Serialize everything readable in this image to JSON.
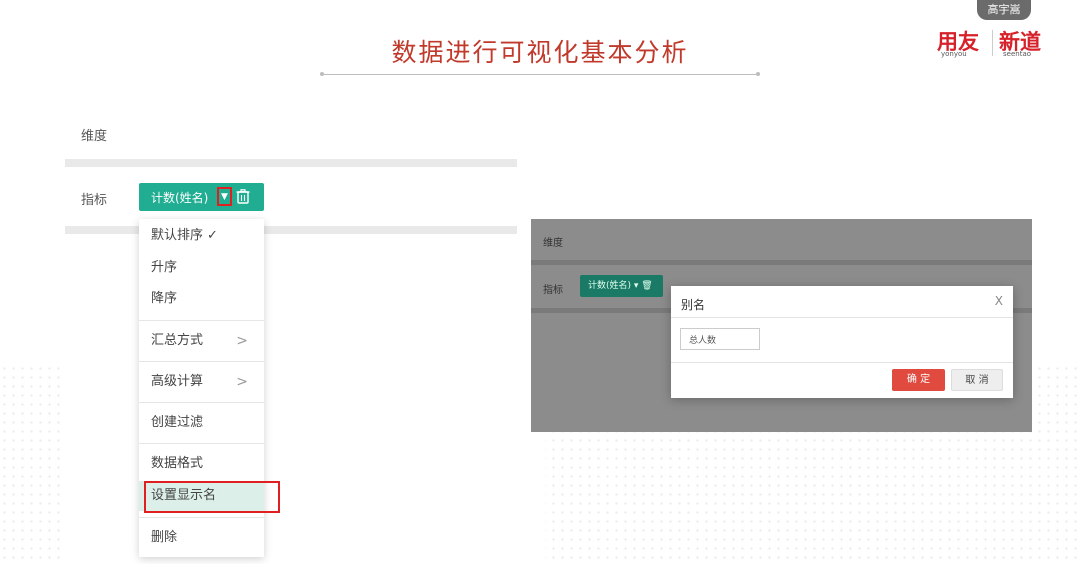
{
  "presenter": {
    "name": "高宇嵩"
  },
  "slide": {
    "title": "数据进行可视化基本分析"
  },
  "logo": {
    "brand1": "用友",
    "brand1_sub": "yonyou",
    "brand2": "新道",
    "brand2_sub": "seentao"
  },
  "left": {
    "dimension_label": "维度",
    "measure_label": "指标",
    "measure_pill": "计数(姓名)",
    "caret_icon": "▼",
    "menu": [
      {
        "label": "默认排序",
        "check": "✓"
      },
      {
        "label": "升序"
      },
      {
        "label": "降序"
      },
      {
        "label": "汇总方式",
        "chev": ">"
      },
      {
        "label": "高级计算",
        "chev": ">"
      },
      {
        "label": "创建过滤"
      },
      {
        "label": "数据格式"
      },
      {
        "label": "设置显示名"
      },
      {
        "label": "删除"
      }
    ]
  },
  "right": {
    "dimension_label": "维度",
    "measure_label": "指标",
    "measure_pill": "计数(姓名)  ▾ 🗑",
    "dialog": {
      "title": "别名",
      "close": "X",
      "input_value": "总人数",
      "ok": "确 定",
      "cancel": "取 消"
    }
  },
  "colors": {
    "accent_green": "#20ad92",
    "title_red": "#c0392b",
    "highlight_red": "#e02020"
  }
}
